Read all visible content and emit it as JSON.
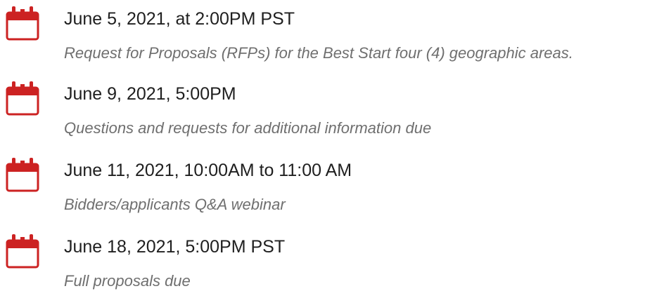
{
  "events": [
    {
      "date": "June 5, 2021, at 2:00PM PST",
      "description": "Request for Proposals (RFPs) for the Best Start four (4) geographic areas.",
      "icon": "calendar-icon"
    },
    {
      "date": "June 9, 2021, 5:00PM",
      "description": "Questions and requests for additional information due",
      "icon": "calendar-icon"
    },
    {
      "date": "June 11, 2021, 10:00AM to 11:00 AM",
      "description": "Bidders/applicants Q&A webinar",
      "icon": "calendar-icon"
    },
    {
      "date": "June 18, 2021, 5:00PM PST",
      "description": "Full proposals due",
      "icon": "calendar-icon"
    }
  ],
  "colors": {
    "icon_red": "#cc2222",
    "date_text": "#1f1f1f",
    "desc_text": "#6f6f6f"
  }
}
